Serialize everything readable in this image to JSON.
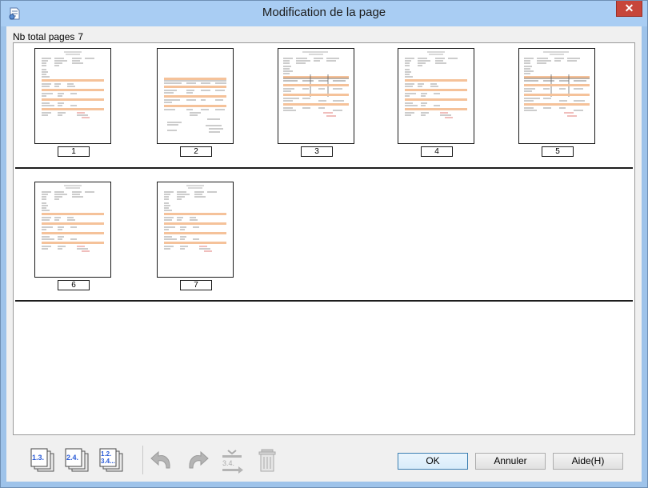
{
  "window": {
    "title": "Modification de la page",
    "close_label": "✕"
  },
  "summary": {
    "label": "Nb total pages",
    "count": "7"
  },
  "pages": [
    {
      "number": "1"
    },
    {
      "number": "2"
    },
    {
      "number": "3"
    },
    {
      "number": "4"
    },
    {
      "number": "5"
    },
    {
      "number": "6"
    },
    {
      "number": "7"
    }
  ],
  "toolbar": {
    "icons": [
      "select-odd-pages-icon",
      "select-even-pages-icon",
      "select-all-pages-icon",
      "rotate-left-icon",
      "rotate-right-icon",
      "reorder-pages-icon",
      "delete-icon"
    ],
    "odd_label_a": "1.3.",
    "even_label_a": "2.4.",
    "all_label_a": "1.2.",
    "all_label_b": "3.4...",
    "reorder_label": "3.4."
  },
  "buttons": {
    "ok": "OK",
    "cancel": "Annuler",
    "help": "Aide(H)"
  },
  "colors": {
    "titlebar": "#a9cdf3",
    "highlight_band": "#f5c29a",
    "accent_blue": "#2a5bd7"
  }
}
